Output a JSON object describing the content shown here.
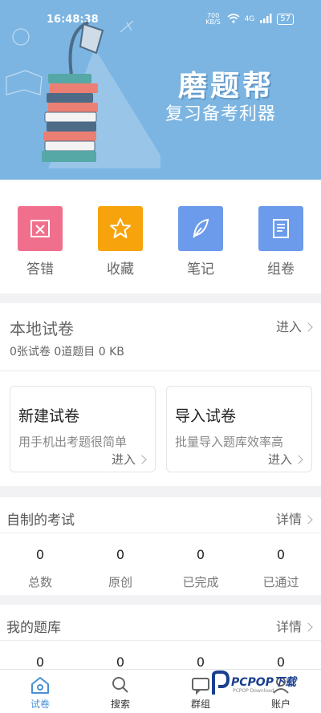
{
  "status_bar": {
    "time": "16:48:38",
    "speed": "700 KB/S",
    "network": "4G",
    "battery": "57"
  },
  "banner": {
    "title": "磨题帮",
    "subtitle": "复习备考利器",
    "bg_color": "#7cb5e2"
  },
  "quick_actions": [
    {
      "label": "答错",
      "icon": "wrong-answers-icon",
      "color": "#f06f8c"
    },
    {
      "label": "收藏",
      "icon": "star-icon",
      "color": "#f7a40c"
    },
    {
      "label": "笔记",
      "icon": "feather-icon",
      "color": "#6b9bea"
    },
    {
      "label": "组卷",
      "icon": "scroll-icon",
      "color": "#6b9bea"
    }
  ],
  "local_papers": {
    "title": "本地试卷",
    "enter_label": "进入",
    "stats": "0张试卷 0道题目 0 KB",
    "cards": [
      {
        "title": "新建试卷",
        "subtitle": "用手机出考题很简单",
        "enter": "进入"
      },
      {
        "title": "导入试卷",
        "subtitle": "批量导入题库效率高",
        "enter": "进入"
      }
    ]
  },
  "my_exams": {
    "title": "自制的考试",
    "more_label": "详情",
    "stats": [
      {
        "value": "0",
        "label": "总数"
      },
      {
        "value": "0",
        "label": "原创"
      },
      {
        "value": "0",
        "label": "已完成"
      },
      {
        "value": "0",
        "label": "已通过"
      }
    ]
  },
  "my_banks": {
    "title": "我的题库",
    "more_label": "详情",
    "stats": [
      {
        "value": "0"
      },
      {
        "value": "0"
      },
      {
        "value": "0"
      },
      {
        "value": "0"
      }
    ]
  },
  "bottom_nav": [
    {
      "label": "试卷",
      "icon": "home-icon",
      "active": true
    },
    {
      "label": "搜索",
      "icon": "search-icon",
      "active": false
    },
    {
      "label": "群组",
      "icon": "chat-icon",
      "active": false
    },
    {
      "label": "账户",
      "icon": "user-icon",
      "active": false
    }
  ],
  "watermark": {
    "text": "PCPOP下载",
    "sub": "PCPOP Download"
  }
}
